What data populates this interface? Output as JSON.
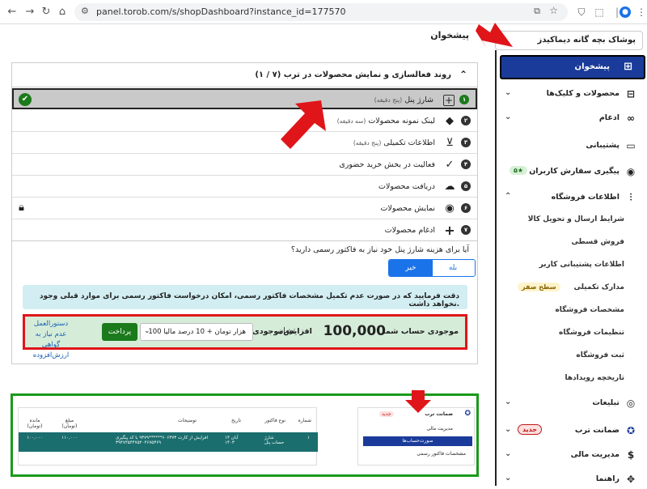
{
  "browser": {
    "url": "panel.torob.com/s/shopDashboard?instance_id=177570"
  },
  "header": {
    "page_title": "پیشخوان",
    "shop_name": "پوشاک بچه گانه دیماکیدز"
  },
  "sidebar": {
    "active": "پیشخوان",
    "items": [
      {
        "label": "محصولات و کلیک‌ها"
      },
      {
        "label": "ادغام"
      },
      {
        "label": "پشتیبانی"
      },
      {
        "label": "پیگیری سفارش کاربران",
        "badge": "۵★"
      },
      {
        "label": "اطلاعات فروشگاه"
      }
    ],
    "sub_items": [
      {
        "label": "شرایط ارسال و تحویل کالا"
      },
      {
        "label": "فروش قسطی"
      },
      {
        "label": "اطلاعات پشتیبانی کاربر"
      },
      {
        "label": "مدارک تکمیلی",
        "badge": "سطح صفر"
      },
      {
        "label": "مشخصات فروشگاه"
      },
      {
        "label": "تنظیمات فروشگاه"
      },
      {
        "label": "ثبت فروشگاه"
      },
      {
        "label": "تاریخچه رویدادها"
      }
    ],
    "bottom_items": [
      {
        "label": "تبلیغات"
      },
      {
        "label": "ضمانت ترب",
        "badge": "جدید"
      },
      {
        "label": "مدیریت مالی"
      },
      {
        "label": "راهنما"
      }
    ]
  },
  "panel": {
    "header": "روند فعالسازی و نمایش محصولات در ترب (۷ / ۱)",
    "steps": [
      {
        "num": "۱",
        "label": "شارژ پنل",
        "hint": "(پنج دقیقه)"
      },
      {
        "num": "۲",
        "label": "لینک نمونه محصولات",
        "hint": "(سه دقیقه)"
      },
      {
        "num": "۳",
        "label": "اطلاعات تکمیلی",
        "hint": "(پنج دقیقه)"
      },
      {
        "num": "۴",
        "label": "فعالیت در بخش خرید حضوری",
        "hint": ""
      },
      {
        "num": "۵",
        "label": "دریافت محصولات",
        "hint": ""
      },
      {
        "num": "۶",
        "label": "نمایش محصولات",
        "hint": ""
      },
      {
        "num": "۷",
        "label": "ادغام محصولات",
        "hint": ""
      }
    ],
    "question": "آیا برای هزینه شارژ پنل خود نیاز به فاکتور رسمی دارید؟",
    "yes": "بله",
    "no": "خیر",
    "info": "دقت فرمایید که در صورت عدم تکمیل مشخصات فاکتور رسمی، امکان درخواست فاکتور رسمی برای موارد قبلی وجود نخواهد داشت.",
    "balance_label": "موجودی حساب شما",
    "balance_value": "100,000",
    "balance_unit": "تومان",
    "increase_label": "افزایش‌موجودی",
    "select_value": "100 هزار تومان + 10 درصد مالیا",
    "pay_button": "پرداخت",
    "vat_link": "دستورالعمل عدم نیاز به گواهی ارزش‌افزوده"
  },
  "guide": {
    "menu_title": "ضمانت ترب",
    "menu_badge": "جدید",
    "menu_sub": "مدیریت مالی",
    "menu_active": "صورت‌حساب‌ها",
    "menu_sub2": "مشخصات فاکتور رسمی",
    "table_headers": [
      "شماره",
      "نوع فاکتور",
      "تاریخ",
      "توضیحات",
      "مبلغ (تومان)",
      "مانده (تومان)"
    ],
    "row": [
      "۱",
      "شارژ حساب پنل",
      "۱۴ آبان ۱۴۰۳",
      "افزایش از کارت ۶۰۶۳۷۳******۹۳۷۹ با کد پیگیری ۳۹۴۷۴۵۴۴۷۵۲۰۴۶۷۵۳۶۹",
      "۱۱۰,۰۰۰",
      "۱۰۰,۰۰۰"
    ]
  },
  "colors": {
    "primary": "#1a3b99",
    "success": "#1b7a1b",
    "info_bg": "#d2eef2",
    "balance_bg": "#d5ecd8",
    "annotation_red": "#e0151a",
    "annotation_green": "#1a9a1a"
  }
}
